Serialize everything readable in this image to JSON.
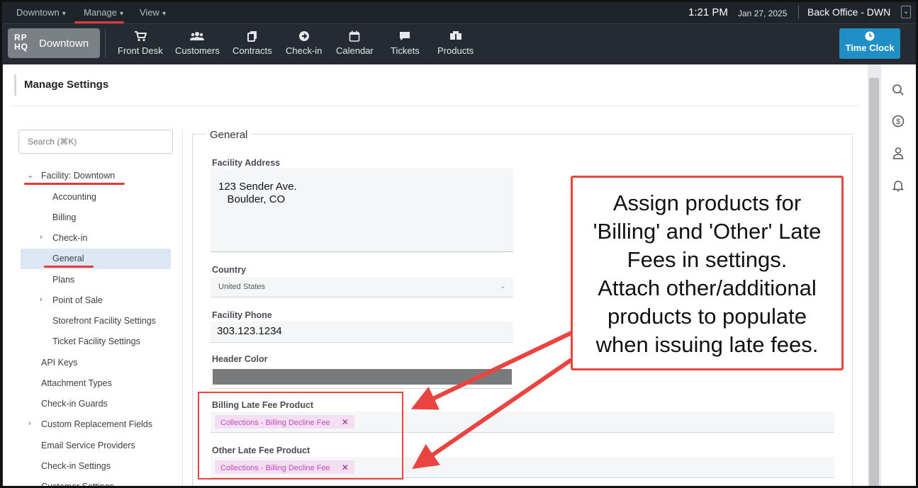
{
  "topbar": {
    "menus": [
      {
        "label": "Downtown"
      },
      {
        "label": "Manage"
      },
      {
        "label": "View"
      }
    ],
    "time": "1:21 PM",
    "date": "Jan 27, 2025",
    "office": "Back Office - DWN"
  },
  "navbar": {
    "logo_mark": "RP HQ",
    "logo_name": "Downtown",
    "items": [
      {
        "label": "Front Desk",
        "icon": "cart-icon"
      },
      {
        "label": "Customers",
        "icon": "users-icon"
      },
      {
        "label": "Contracts",
        "icon": "copy-icon"
      },
      {
        "label": "Check-in",
        "icon": "arrow-circle-icon"
      },
      {
        "label": "Calendar",
        "icon": "calendar-icon"
      },
      {
        "label": "Tickets",
        "icon": "chat-icon"
      },
      {
        "label": "Products",
        "icon": "boxes-icon"
      }
    ],
    "time_clock": "Time Clock"
  },
  "page": {
    "title": "Manage Settings",
    "search_placeholder": "Search (⌘K)"
  },
  "tree": {
    "facility": "Facility: Downtown",
    "children": [
      "Accounting",
      "Billing",
      "Check-in",
      "General",
      "Plans",
      "Point of Sale",
      "Storefront Facility Settings",
      "Ticket Facility Settings"
    ],
    "top_level": [
      "API Keys",
      "Attachment Types",
      "Check-in Guards",
      "Custom Replacement Fields",
      "Email Service Providers",
      "Check-in Settings",
      "Customer Settings"
    ]
  },
  "general": {
    "legend": "General",
    "address_label": "Facility Address",
    "address_value": "123 Sender Ave.\n   Boulder, CO",
    "country_label": "Country",
    "country_value": "United States",
    "phone_label": "Facility Phone",
    "phone_value": "303.123.1234",
    "header_color_label": "Header Color",
    "header_color": "#787a7c",
    "billing_fee_label": "Billing Late Fee Product",
    "billing_fee_tag": "Collections - Billing Decline Fee",
    "other_fee_label": "Other Late Fee Product",
    "other_fee_tag": "Collections - Billing Decline Fee"
  },
  "callout": {
    "lines": [
      "Assign products for",
      "'Billing' and 'Other' Late",
      "Fees in settings.",
      "Attach other/additional",
      "products to populate",
      "when issuing late fees."
    ]
  },
  "colors": {
    "accent": "#1f8fc6",
    "annotation_red": "#e9443f",
    "tag_bg": "#f4dff2",
    "tag_text": "#c04cb9",
    "selected_bg": "#dde7f3"
  }
}
